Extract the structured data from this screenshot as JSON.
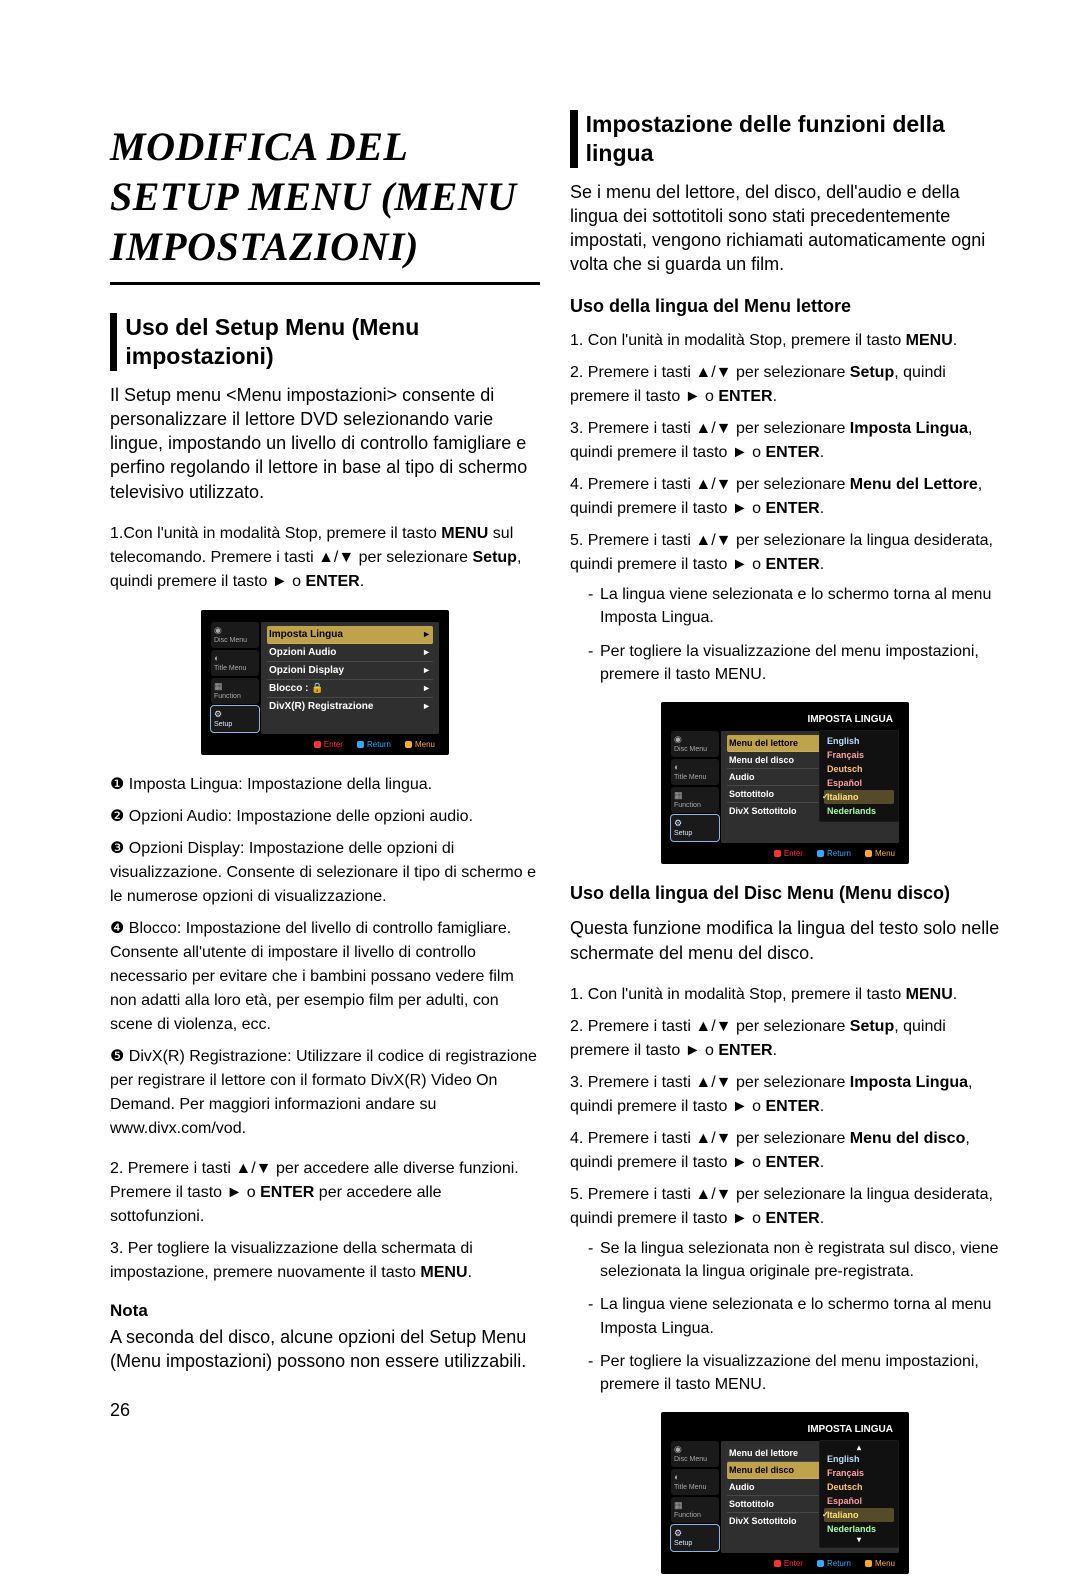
{
  "pageNumber": "26",
  "title": "MODIFICA DEL SETUP MENU (MENU IMPOSTAZIONI)",
  "left": {
    "section1_title": "Uso del Setup Menu (Menu impostazioni)",
    "intro": "Il Setup menu <Menu impostazioni> consente di personalizzare il lettore DVD selezionando varie lingue, impostando un livello di controllo famigliare e perfino regolando il lettore in base al tipo di schermo televisivo utilizzato.",
    "step1_pre": "1.Con l'unità in modalità Stop, premere il tasto ",
    "step1_menu": "MENU",
    "step1_mid": " sul telecomando. Premere i tasti ▲/▼ per selezionare ",
    "step1_setup": "Setup",
    "step1_post": ", quindi premere il tasto ► o ",
    "step1_enter": "ENTER",
    "step1_dot": ".",
    "bullets": [
      "Imposta Lingua: Impostazione della lingua.",
      "Opzioni Audio: Impostazione delle opzioni audio.",
      "Opzioni Display: Impostazione delle opzioni di visualizzazione. Consente di selezionare il tipo di schermo e le numerose opzioni di visualizzazione.",
      "Blocco: Impostazione del livello di controllo famigliare. Consente all'utente di impostare il livello di controllo necessario per evitare che i bambini possano vedere film non adatti alla loro età, per esempio film per adulti, con scene di violenza, ecc.",
      "DivX(R) Registrazione: Utilizzare il codice di registrazione per registrare il lettore con il formato DivX(R) Video On Demand. Per maggiori informazioni andare su www.divx.com/vod."
    ],
    "bullet_nums": [
      "❶",
      "❷",
      "❸",
      "❹",
      "❺"
    ],
    "step2_pre": "2. Premere i tasti ▲/▼ per accedere alle diverse funzioni. Premere il tasto ► o ",
    "step2_enter": "ENTER",
    "step2_post": " per accedere alle sottofunzioni.",
    "step3_pre": "3. Per togliere la visualizzazione della schermata di impostazione, premere nuovamente il tasto ",
    "step3_menu": "MENU",
    "step3_dot": ".",
    "nota_head": "Nota",
    "nota_body": "A seconda del disco, alcune opzioni del Setup Menu (Menu impostazioni) possono non essere utilizzabili."
  },
  "right": {
    "section_title": "Impostazione delle funzioni della lingua",
    "intro": "Se i menu del lettore, del disco, dell'audio e della lingua dei sottotitoli sono stati precedentemente impostati, vengono richiamati automaticamente ogni volta che si guarda un film.",
    "subA_head": "Uso della lingua del Menu lettore",
    "subA_items": {
      "i1_pre": "1. Con l'unità in modalità Stop, premere il tasto ",
      "i1_menu": "MENU",
      "i1_dot": ".",
      "i2_pre": "2. Premere i tasti ▲/▼ per selezionare ",
      "i2_setup": "Setup",
      "i2_post": ", quindi premere il tasto ► o ",
      "i2_enter": "ENTER",
      "i2_dot": ".",
      "i3_pre": "3. Premere i tasti ▲/▼ per selezionare ",
      "i3_b": "Imposta Lingua",
      "i3_post": ", quindi premere il tasto ► o ",
      "i3_enter": "ENTER",
      "i3_dot": ".",
      "i4_pre": "4. Premere i tasti ▲/▼ per selezionare ",
      "i4_b": "Menu del Lettore",
      "i4_post": ", quindi premere il tasto ► o ",
      "i4_enter": "ENTER",
      "i4_dot": ".",
      "i5_pre": "5. Premere i tasti ▲/▼ per selezionare la lingua desiderata, quindi premere il tasto ► o ",
      "i5_enter": "ENTER",
      "i5_dot": "."
    },
    "subA_subs": [
      "La lingua viene selezionata e lo schermo torna al menu Imposta Lingua.",
      "Per togliere la visualizzazione del menu impostazioni, premere il tasto MENU."
    ],
    "subB_head": "Uso della lingua del Disc Menu (Menu disco)",
    "subB_intro": "Questa funzione modifica la lingua del testo solo nelle schermate del menu del disco.",
    "subB_items": {
      "i1_pre": "1. Con l'unità in modalità Stop, premere il tasto ",
      "i1_menu": "MENU",
      "i1_dot": ".",
      "i2_pre": "2. Premere i tasti ▲/▼ per selezionare ",
      "i2_setup": "Setup",
      "i2_post": ", quindi premere il tasto ► o ",
      "i2_enter": "ENTER",
      "i2_dot": ".",
      "i3_pre": "3. Premere i tasti ▲/▼ per selezionare ",
      "i3_b": "Imposta Lingua",
      "i3_post": ", quindi premere il tasto ► o ",
      "i3_enter": "ENTER",
      "i3_dot": ".",
      "i4_pre": "4. Premere i tasti ▲/▼ per selezionare ",
      "i4_b": "Menu del disco",
      "i4_post": ", quindi premere il tasto ► o ",
      "i4_enter": "ENTER",
      "i4_dot": ".",
      "i5_pre": "5. Premere i tasti ▲/▼ per selezionare la lingua desiderata, quindi premere il tasto ► o ",
      "i5_enter": "ENTER",
      "i5_dot": "."
    },
    "subB_subs": [
      "Se la lingua selezionata non è registrata sul disco, viene selezionata la lingua originale pre-registrata.",
      "La lingua viene selezionata e lo schermo torna al menu Imposta Lingua.",
      "Per togliere la visualizzazione del menu impostazioni, premere il tasto MENU."
    ]
  },
  "osd": {
    "side": {
      "disc": "Disc Menu",
      "title": "Title Menu",
      "func": "Function",
      "setup": "Setup"
    },
    "header": "IMPOSTA LINGUA",
    "menu_main": [
      "Imposta Lingua",
      "Opzioni Audio",
      "Opzioni Display",
      "Blocco :",
      "DivX(R) Registrazione"
    ],
    "menu_lang_list": [
      "Menu del lettore",
      "Menu del disco",
      "Audio",
      "Sottotitolo",
      "DivX Sottotitolo"
    ],
    "lang_pop": [
      "English",
      "Français",
      "Deutsch",
      "Español",
      "Italiano",
      "Nederlands"
    ],
    "footer": {
      "enter": "Enter",
      "return": "Return",
      "menu": "Menu"
    },
    "blocco_icon": "🔒"
  }
}
